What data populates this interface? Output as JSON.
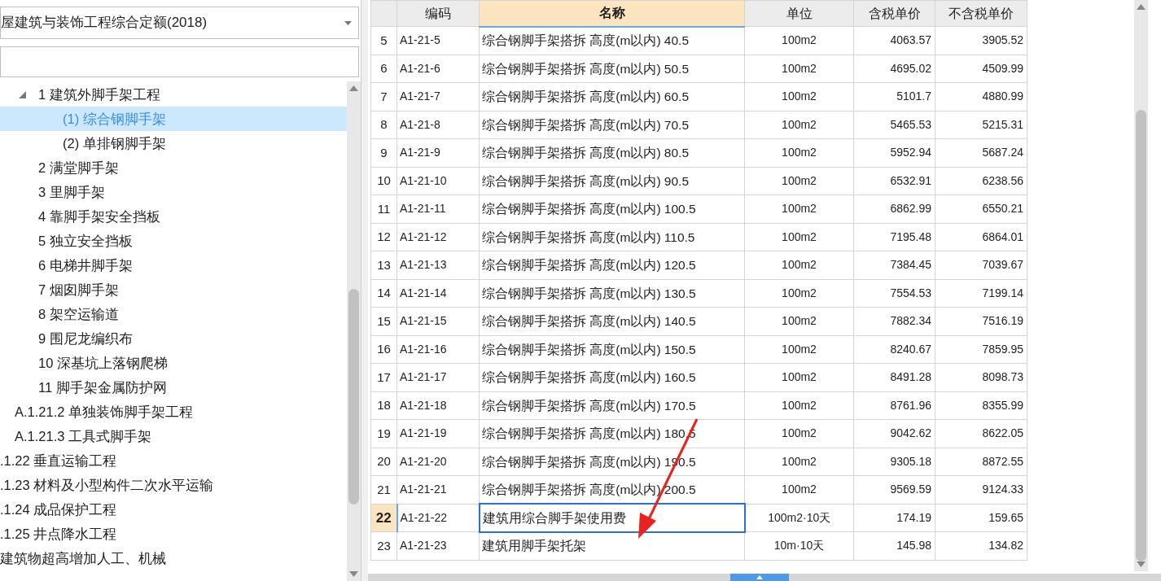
{
  "library_select": {
    "value": "屋建筑与装饰工程综合定额(2018)"
  },
  "tree": [
    {
      "children": [
        {
          "children": [
            {
              "label": "1 建筑外脚手架工程",
              "selected": false,
              "expanded": true,
              "children": [
                {
                  "label": "(1) 综合钢脚手架",
                  "selected": true
                },
                {
                  "label": "(2) 单排钢脚手架",
                  "selected": false
                }
              ]
            },
            {
              "label": "2 满堂脚手架",
              "selected": false
            },
            {
              "label": "3 里脚手架",
              "selected": false
            },
            {
              "label": "4 靠脚手架安全挡板",
              "selected": false
            },
            {
              "label": "5 独立安全挡板",
              "selected": false
            },
            {
              "label": "6 电梯井脚手架",
              "selected": false
            },
            {
              "label": "7 烟囱脚手架",
              "selected": false
            },
            {
              "label": "8 架空运输道",
              "selected": false
            },
            {
              "label": "9 围尼龙编织布",
              "selected": false
            },
            {
              "label": "10 深基坑上落钢爬梯",
              "selected": false
            },
            {
              "label": "11 脚手架金属防护网",
              "selected": false
            }
          ]
        },
        {
          "label": "A.1.21.2 单独装饰脚手架工程",
          "selected": false
        },
        {
          "label": "A.1.21.3 工具式脚手架",
          "selected": false
        }
      ]
    },
    {
      "label": ".1.22 垂直运输工程",
      "selected": false
    },
    {
      "label": ".1.23 材料及小型构件二次水平运输",
      "selected": false
    },
    {
      "label": ".1.24 成品保护工程",
      "selected": false
    },
    {
      "label": ".1.25 井点降水工程",
      "selected": false
    },
    {
      "label": "建筑物超高增加人工、机械",
      "selected": false
    }
  ],
  "table": {
    "columns": [
      {
        "label": "编码",
        "selected": false
      },
      {
        "label": "名称",
        "selected": true
      },
      {
        "label": "单位",
        "selected": false
      },
      {
        "label": "含税单价",
        "selected": false
      },
      {
        "label": "不含税单价",
        "selected": false
      }
    ],
    "rows": [
      {
        "num": "5",
        "selected": false,
        "cells": [
          "A1-21-5",
          "综合钢脚手架搭拆 高度(m以内) 40.5",
          "100m2",
          "4063.57",
          "3905.52"
        ]
      },
      {
        "num": "6",
        "selected": false,
        "cells": [
          "A1-21-6",
          "综合钢脚手架搭拆 高度(m以内) 50.5",
          "100m2",
          "4695.02",
          "4509.99"
        ]
      },
      {
        "num": "7",
        "selected": false,
        "cells": [
          "A1-21-7",
          "综合钢脚手架搭拆 高度(m以内) 60.5",
          "100m2",
          "5101.7",
          "4880.99"
        ]
      },
      {
        "num": "8",
        "selected": false,
        "cells": [
          "A1-21-8",
          "综合钢脚手架搭拆 高度(m以内) 70.5",
          "100m2",
          "5465.53",
          "5215.31"
        ]
      },
      {
        "num": "9",
        "selected": false,
        "cells": [
          "A1-21-9",
          "综合钢脚手架搭拆 高度(m以内) 80.5",
          "100m2",
          "5952.94",
          "5687.24"
        ]
      },
      {
        "num": "10",
        "selected": false,
        "cells": [
          "A1-21-10",
          "综合钢脚手架搭拆 高度(m以内) 90.5",
          "100m2",
          "6532.91",
          "6238.56"
        ]
      },
      {
        "num": "11",
        "selected": false,
        "cells": [
          "A1-21-11",
          "综合钢脚手架搭拆 高度(m以内) 100.5",
          "100m2",
          "6862.99",
          "6550.21"
        ]
      },
      {
        "num": "12",
        "selected": false,
        "cells": [
          "A1-21-12",
          "综合钢脚手架搭拆 高度(m以内) 110.5",
          "100m2",
          "7195.48",
          "6864.01"
        ]
      },
      {
        "num": "13",
        "selected": false,
        "cells": [
          "A1-21-13",
          "综合钢脚手架搭拆 高度(m以内) 120.5",
          "100m2",
          "7384.45",
          "7039.67"
        ]
      },
      {
        "num": "14",
        "selected": false,
        "cells": [
          "A1-21-14",
          "综合钢脚手架搭拆 高度(m以内) 130.5",
          "100m2",
          "7554.53",
          "7199.14"
        ]
      },
      {
        "num": "15",
        "selected": false,
        "cells": [
          "A1-21-15",
          "综合钢脚手架搭拆 高度(m以内) 140.5",
          "100m2",
          "7882.34",
          "7516.19"
        ]
      },
      {
        "num": "16",
        "selected": false,
        "cells": [
          "A1-21-16",
          "综合钢脚手架搭拆 高度(m以内) 150.5",
          "100m2",
          "8240.67",
          "7859.95"
        ]
      },
      {
        "num": "17",
        "selected": false,
        "cells": [
          "A1-21-17",
          "综合钢脚手架搭拆 高度(m以内) 160.5",
          "100m2",
          "8491.28",
          "8098.73"
        ]
      },
      {
        "num": "18",
        "selected": false,
        "cells": [
          "A1-21-18",
          "综合钢脚手架搭拆 高度(m以内) 170.5",
          "100m2",
          "8761.96",
          "8355.99"
        ]
      },
      {
        "num": "19",
        "selected": false,
        "cells": [
          "A1-21-19",
          "综合钢脚手架搭拆 高度(m以内) 180.5",
          "100m2",
          "9042.62",
          "8622.05"
        ]
      },
      {
        "num": "20",
        "selected": false,
        "cells": [
          "A1-21-20",
          "综合钢脚手架搭拆 高度(m以内) 190.5",
          "100m2",
          "9305.18",
          "8872.55"
        ]
      },
      {
        "num": "21",
        "selected": false,
        "cells": [
          "A1-21-21",
          "综合钢脚手架搭拆 高度(m以内) 200.5",
          "100m2",
          "9569.59",
          "9124.33"
        ]
      },
      {
        "num": "22",
        "selected": true,
        "cells": [
          "A1-21-22",
          "建筑用综合脚手架使用费",
          "100m2·10天",
          "174.19",
          "159.65"
        ]
      },
      {
        "num": "23",
        "selected": false,
        "cells": [
          "A1-21-23",
          "建筑用脚手架托架",
          "10m·10天",
          "145.98",
          "134.82"
        ]
      }
    ]
  }
}
